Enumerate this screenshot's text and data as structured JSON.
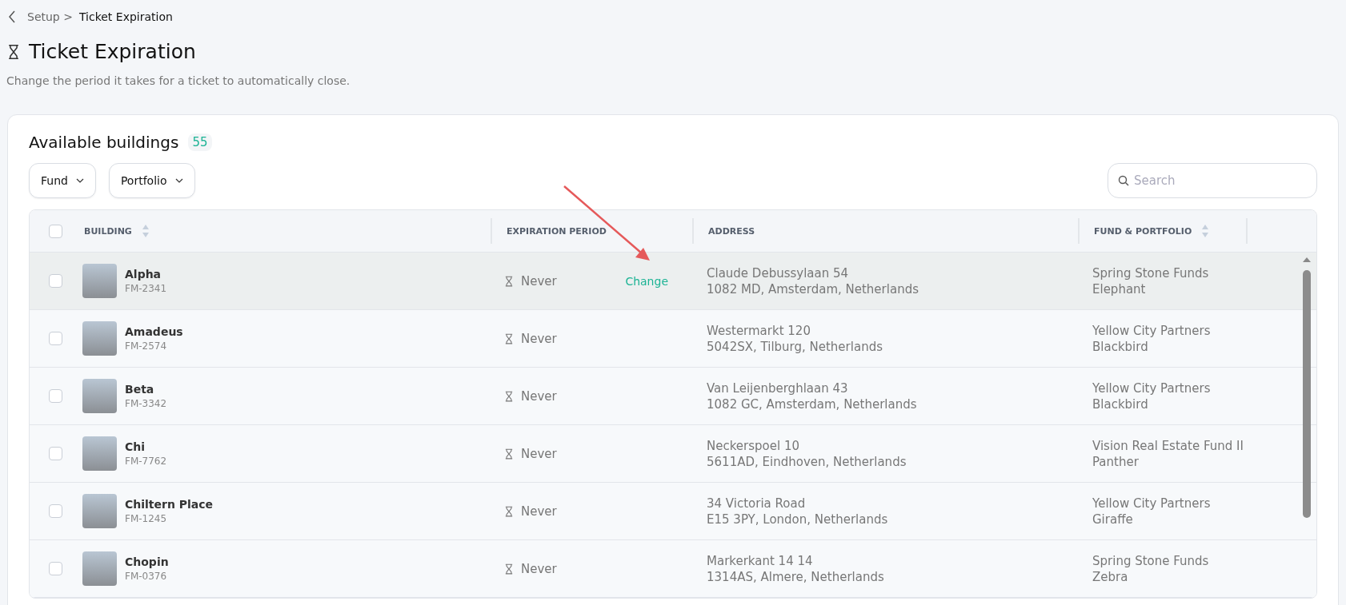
{
  "breadcrumb": {
    "parent": "Setup >",
    "current": "Ticket Expiration"
  },
  "page": {
    "title": "Ticket Expiration",
    "subtitle": "Change the period it takes for a ticket to automatically close."
  },
  "card": {
    "title": "Available buildings",
    "count": "55",
    "filters": [
      "Fund",
      "Portfolio"
    ],
    "search": {
      "placeholder": "Search"
    },
    "table": {
      "header_checked": false,
      "columns": [
        {
          "label": "BUILDING",
          "sortable": true
        },
        {
          "label": "EXPIRATION PERIOD",
          "sortable": false
        },
        {
          "label": "ADDRESS",
          "sortable": false
        },
        {
          "label": "FUND & PORTFOLIO",
          "sortable": true
        }
      ],
      "rows": [
        {
          "name": "Alpha",
          "code": "FM-2341",
          "period": "Never",
          "action": "Change",
          "highlighted": true,
          "checked": false,
          "address1": "Claude Debussylaan 54",
          "address2": "1082 MD, Amsterdam, Netherlands",
          "fund": "Spring Stone Funds",
          "portfolio": "Elephant"
        },
        {
          "name": "Amadeus",
          "code": "FM-2574",
          "period": "Never",
          "highlighted": false,
          "checked": false,
          "address1": "Westermarkt 120",
          "address2": "5042SX, Tilburg, Netherlands",
          "fund": "Yellow City Partners",
          "portfolio": "Blackbird"
        },
        {
          "name": "Beta",
          "code": "FM-3342",
          "period": "Never",
          "highlighted": false,
          "checked": false,
          "address1": "Van Leijenberghlaan 43",
          "address2": "1082 GC, Amsterdam, Netherlands",
          "fund": "Yellow City Partners",
          "portfolio": "Blackbird"
        },
        {
          "name": "Chi",
          "code": "FM-7762",
          "period": "Never",
          "highlighted": false,
          "checked": false,
          "address1": "Neckerspoel 10",
          "address2": "5611AD, Eindhoven, Netherlands",
          "fund": "Vision Real Estate Fund II",
          "portfolio": "Panther"
        },
        {
          "name": "Chiltern Place",
          "code": "FM-1245",
          "period": "Never",
          "highlighted": false,
          "checked": false,
          "address1": "34 Victoria Road",
          "address2": "E15 3PY, London, Netherlands",
          "fund": "Yellow City Partners",
          "portfolio": "Giraffe"
        },
        {
          "name": "Chopin",
          "code": "FM-0376",
          "period": "Never",
          "highlighted": false,
          "checked": false,
          "address1": "Markerkant 14 14",
          "address2": "1314AS, Almere, Netherlands",
          "fund": "Spring Stone Funds",
          "portfolio": "Zebra"
        }
      ]
    }
  }
}
